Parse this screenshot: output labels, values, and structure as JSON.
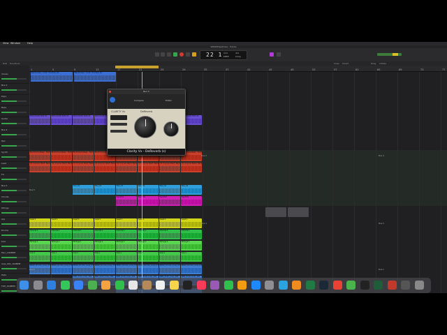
{
  "menubar": {
    "items": [
      "View",
      "Window",
      "Help"
    ]
  },
  "window": {
    "title": "W0W3Headlines - Tracks"
  },
  "transport": {
    "position": "22 1",
    "tempo": "110",
    "tempo_label": "KEEP",
    "signature": "4/4",
    "key": "Cmaj",
    "meter_level": 0.8
  },
  "toolbar": {
    "edit_label": "Edit",
    "functions_label": "Functions",
    "snap_label": "Snap",
    "snap_value": "Smart",
    "drag_label": "Drag",
    "drag_value": "X-Fade"
  },
  "ruler": {
    "bars": [
      "1",
      "5",
      "9",
      "13",
      "17",
      "21",
      "25",
      "29",
      "33",
      "37",
      "41",
      "45",
      "49",
      "53",
      "57",
      "61",
      "65",
      "69",
      "73",
      "77"
    ]
  },
  "markers": [
    "Bus 4",
    "Bus 4",
    "Bus 5",
    "Bus 5",
    "Bus 4",
    "Bus 1",
    "Bus 1"
  ],
  "tracks": [
    {
      "name": "Vocals"
    },
    {
      "name": "Bus 2"
    },
    {
      "name": "Keys"
    },
    {
      "name": "Bass"
    },
    {
      "name": "Guitar"
    },
    {
      "name": "Bus 4"
    },
    {
      "name": "Pad"
    },
    {
      "name": "Synth"
    },
    {
      "name": "Lead"
    },
    {
      "name": "FX"
    },
    {
      "name": "Bus 5"
    },
    {
      "name": "Chords"
    },
    {
      "name": "Strings"
    },
    {
      "name": "Arp"
    },
    {
      "name": "Drums"
    },
    {
      "name": "Kick"
    },
    {
      "name": "Perc_102BPM"
    },
    {
      "name": "loop_001_102BPM"
    },
    {
      "name": "Hats"
    },
    {
      "name": "TOP_102BPM"
    }
  ],
  "regions": [
    {
      "label": "Backvoxes - Cont. 3 la Rob_01",
      "color": "#3b6fd6"
    },
    {
      "label": "Backvoxes - Cont. 3 la Rob_01",
      "color": "#3b6fd6"
    },
    {
      "label": "MKS DIARY BUS 01",
      "color": "#6a4fd0"
    },
    {
      "label": "MuchCone Bass - Bum",
      "color": "#c9402c"
    },
    {
      "label": "A1 Anyone Stack Bass",
      "color": "#c9402c"
    },
    {
      "label": "Pad_01",
      "color": "#2fa0db"
    },
    {
      "label": "Synth 6",
      "color": "#d01fb4"
    },
    {
      "label": "Lead 1",
      "color": "#d2d619"
    },
    {
      "label": "Chords 1",
      "color": "#2fbf4b"
    },
    {
      "label": "Strings 1",
      "color": "#58d64e"
    },
    {
      "label": "Arp 1",
      "color": "#43c94a"
    },
    {
      "label": "BASS_Drums_Loop_01",
      "color": "#3f7ed1"
    },
    {
      "label": "808_drum_loop_102",
      "color": "#3f7ed1"
    },
    {
      "label": "HATS_Top-Loop 2_1",
      "color": "#3f7ed1"
    }
  ],
  "plugin": {
    "window_title": "Bus 3",
    "preset": "Compare",
    "mode": "Editor",
    "brand": "CLARITY Vx",
    "product": "DeReverb",
    "footer": "Clarity Vx - DeReverb (s)"
  },
  "dock": {
    "icons": [
      "finder-icon",
      "launchpad-icon",
      "safari-icon",
      "messages-icon",
      "mail-icon",
      "maps-icon",
      "photos-icon",
      "facetime-icon",
      "calendar-icon",
      "contacts-icon",
      "reminders-icon",
      "notes-icon",
      "tv-icon",
      "music-icon",
      "podcasts-icon",
      "numbers-icon",
      "pages-icon",
      "app-store-icon",
      "settings-icon",
      "telegram-icon",
      "vlc-icon",
      "excel-icon",
      "steam-icon",
      "chrome-icon",
      "utorrent-icon",
      "terminal-icon",
      "audition-icon",
      "plugin-icon",
      "activity-icon",
      "trash-icon"
    ]
  }
}
